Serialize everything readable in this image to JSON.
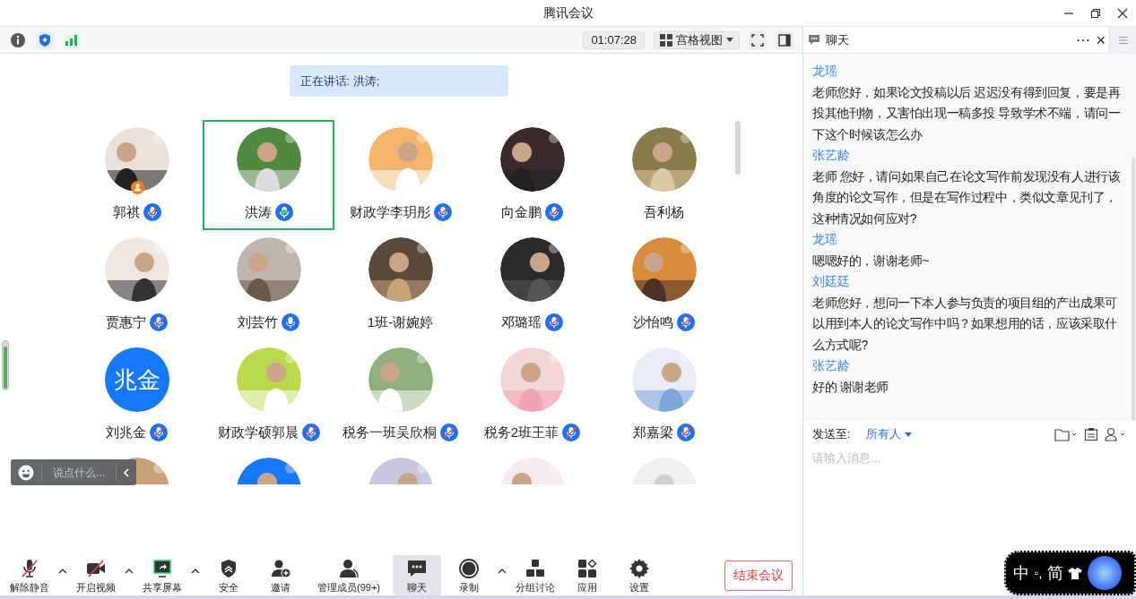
{
  "window": {
    "title": "腾讯会议"
  },
  "top_bar": {
    "timer": "01:07:28",
    "view_button": "宫格视图"
  },
  "speaking_banner": "正在讲话: 洪涛;",
  "participants": [
    {
      "name": "郭祺",
      "kind": "picture",
      "mic_shown": true,
      "muted": true,
      "speaking": false,
      "host": true,
      "selected": false
    },
    {
      "name": "洪涛",
      "kind": "picture",
      "mic_shown": true,
      "muted": false,
      "speaking": true,
      "host": false,
      "selected": true
    },
    {
      "name": "财政学李玥彤",
      "kind": "picture",
      "mic_shown": true,
      "muted": true,
      "speaking": false,
      "host": false,
      "selected": false
    },
    {
      "name": "向金鹏",
      "kind": "picture",
      "mic_shown": true,
      "muted": true,
      "speaking": false,
      "host": false,
      "selected": false
    },
    {
      "name": "吾利杨",
      "kind": "picture",
      "mic_shown": false,
      "host": false,
      "selected": false
    },
    {
      "name": "贾惠宁",
      "kind": "picture",
      "mic_shown": true,
      "muted": true,
      "speaking": false,
      "host": false,
      "selected": false
    },
    {
      "name": "刘芸竹",
      "kind": "picture",
      "mic_shown": true,
      "muted": false,
      "speaking": false,
      "host": false,
      "selected": false
    },
    {
      "name": "1班-谢婉婷",
      "kind": "picture",
      "mic_shown": false,
      "host": false,
      "selected": false
    },
    {
      "name": "邓璐瑶",
      "kind": "picture",
      "mic_shown": true,
      "muted": true,
      "speaking": false,
      "host": false,
      "selected": false
    },
    {
      "name": "沙怡鸣",
      "kind": "picture",
      "mic_shown": true,
      "muted": true,
      "speaking": false,
      "host": false,
      "selected": false
    },
    {
      "name": "刘兆金",
      "kind": "initials",
      "initials": "兆金",
      "mic_shown": true,
      "muted": true,
      "speaking": false,
      "host": false,
      "selected": false
    },
    {
      "name": "财政学硕郭晨",
      "kind": "picture",
      "mic_shown": true,
      "muted": true,
      "speaking": false,
      "host": false,
      "selected": false
    },
    {
      "name": "税务一班吴欣桐",
      "kind": "picture",
      "mic_shown": true,
      "muted": true,
      "speaking": false,
      "host": false,
      "selected": false
    },
    {
      "name": "税务2班王菲",
      "kind": "picture",
      "mic_shown": true,
      "muted": true,
      "speaking": false,
      "host": false,
      "selected": false
    },
    {
      "name": "郑嘉梁",
      "kind": "picture",
      "mic_shown": true,
      "muted": true,
      "speaking": false,
      "host": false,
      "selected": false
    },
    {
      "kind": "picture"
    },
    {
      "kind": "picture"
    },
    {
      "kind": "picture"
    },
    {
      "kind": "picture"
    },
    {
      "kind": "default"
    }
  ],
  "quick_comment": {
    "placeholder": "说点什么..."
  },
  "toolbar": [
    {
      "label": "解除静音",
      "has_menu": true,
      "off": true,
      "selected": false
    },
    {
      "label": "开启视频",
      "has_menu": true,
      "off": true,
      "selected": false
    },
    {
      "label": "共享屏幕",
      "has_menu": true,
      "off": false,
      "selected": false
    },
    {
      "label": "安全",
      "has_menu": false,
      "off": false,
      "selected": false
    },
    {
      "label": "邀请",
      "has_menu": false,
      "off": false,
      "selected": false
    },
    {
      "label": "管理成员(99+)",
      "has_menu": false,
      "off": false,
      "selected": false
    },
    {
      "label": "聊天",
      "has_menu": false,
      "off": false,
      "selected": true
    },
    {
      "label": "录制",
      "has_menu": true,
      "off": false,
      "selected": false
    },
    {
      "label": "分组讨论",
      "has_menu": false,
      "off": false,
      "selected": false
    },
    {
      "label": "应用",
      "has_menu": false,
      "off": false,
      "selected": false
    },
    {
      "label": "设置",
      "has_menu": false,
      "off": false,
      "selected": false
    }
  ],
  "end_button": "结束会议",
  "chat": {
    "title": "聊天",
    "more": "⋯",
    "close": "×",
    "messages": [
      {
        "sender": "龙瑶",
        "text": "老师您好，如果论文投稿以后 迟迟没有得到回复，要是再投其他刊物，又害怕出现一稿多投 导致学术不端，请问一下这个时候该怎么办"
      },
      {
        "sender": "张艺龄",
        "text": "老师 您好，请问如果自己在论文写作前发现没有人进行该角度的论文写作，但是在写作过程中，类似文章见刊了，这种情况如何应对?"
      },
      {
        "sender": "龙瑶",
        "text": "嗯嗯好的，谢谢老师~"
      },
      {
        "sender": "刘廷廷",
        "text": "老师您好，想问一下本人参与负责的项目组的产出成果可以用到本人的论文写作中吗？如果想用的话，应该采取什么方式呢?"
      },
      {
        "sender": "张艺龄",
        "text": "好的 谢谢老师"
      }
    ],
    "send_to_label": "发送至:",
    "recipient": "所有人",
    "input_placeholder": "请输入消息..."
  },
  "ime": {
    "mode": "中",
    "punctuation": "◦,",
    "script": "简"
  }
}
